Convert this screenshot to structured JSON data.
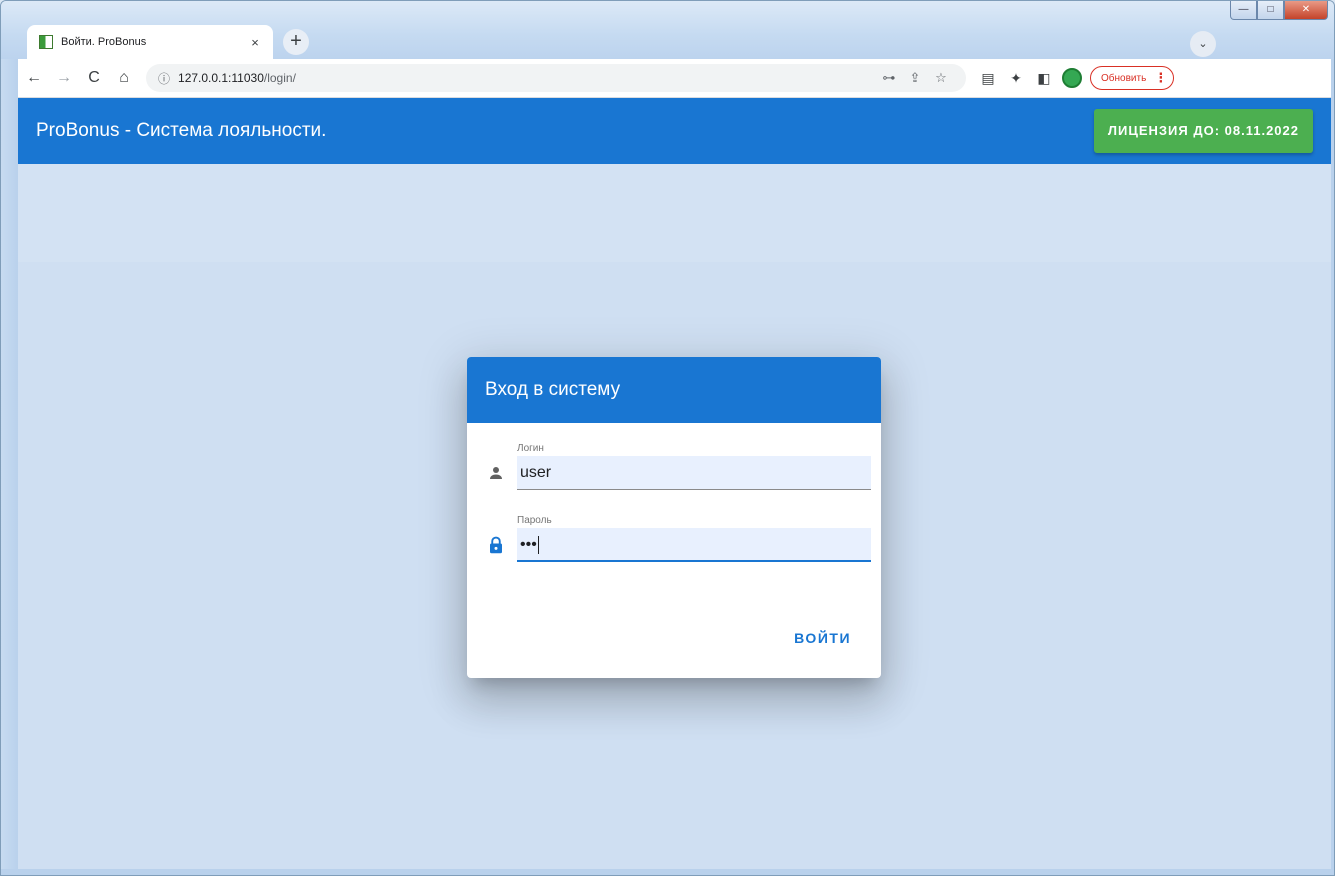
{
  "browser": {
    "tab_title": "Войти. ProBonus",
    "tab_close": "×",
    "new_tab": "+",
    "tab_search": "⌄",
    "url_host": "127.0.0.1:11030",
    "url_path": "/login/",
    "update_label": "Обновить",
    "update_menu": "⋮",
    "window": {
      "minimize": "—",
      "maximize": "□",
      "close": "✕"
    },
    "nav": {
      "back": "←",
      "forward": "→",
      "reload": "C",
      "home": "⌂"
    },
    "info_icon": "ⓘ",
    "omni_icons": {
      "key": "⊶",
      "share": "⇪",
      "star": "☆"
    },
    "ext_icons": {
      "reading": "▤",
      "extensions": "✦",
      "sidepanel": "◧"
    }
  },
  "app": {
    "title": "ProBonus - Система лояльности.",
    "license_label": "ЛИЦЕНЗИЯ ДО: 08.11.2022"
  },
  "dialog": {
    "title": "Вход в систему",
    "login_label": "Логин",
    "login_value": "user",
    "password_label": "Пароль",
    "password_value": "•••",
    "submit_label": "ВОЙТИ"
  },
  "colors": {
    "primary": "#1976d2",
    "license": "#4caf50",
    "background": "#cfdff2"
  }
}
